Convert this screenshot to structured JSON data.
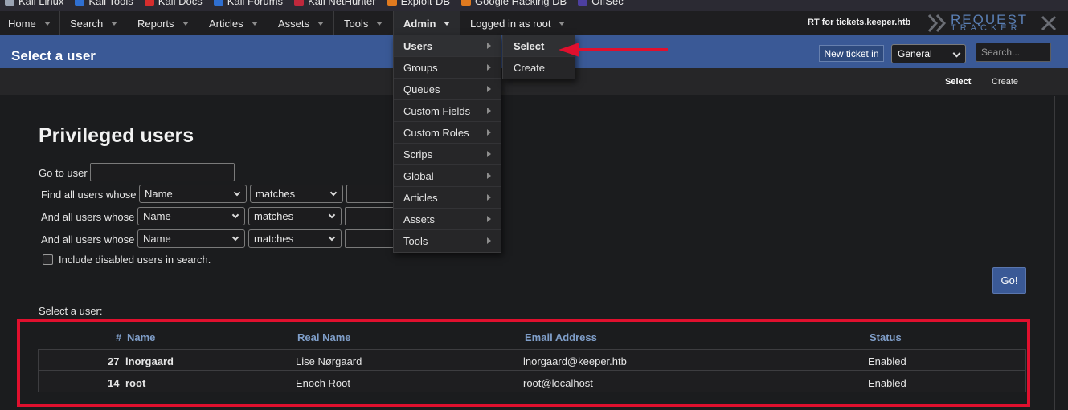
{
  "bookmarks": [
    {
      "label": "Kali Linux",
      "icon": "kali-icon",
      "color": "#9aa3b3"
    },
    {
      "label": "Kali Tools",
      "icon": "kali-icon",
      "color": "#2f6fd1"
    },
    {
      "label": "Kali Docs",
      "icon": "docs-icon",
      "color": "#d62d2d"
    },
    {
      "label": "Kali Forums",
      "icon": "kali-icon",
      "color": "#2f6fd1"
    },
    {
      "label": "Kali NetHunter",
      "icon": "nethunter-icon",
      "color": "#c0283c"
    },
    {
      "label": "Exploit-DB",
      "icon": "exploitdb-icon",
      "color": "#e07a1f"
    },
    {
      "label": "Google Hacking DB",
      "icon": "exploitdb-icon",
      "color": "#e07a1f"
    },
    {
      "label": "OffSec",
      "icon": "offsec-icon",
      "color": "#4d3fa0"
    }
  ],
  "nav": {
    "items": [
      "Home",
      "Search",
      "Reports",
      "Articles",
      "Assets",
      "Tools",
      "Admin",
      "Logged in as root"
    ],
    "host": "RT for tickets.keeper.htb",
    "logo_top": "REQUEST",
    "logo_bottom": "TRACKER"
  },
  "titlebar": {
    "title": "Select a user",
    "new_ticket": "New ticket in",
    "queue": "General",
    "search_placeholder": "Search..."
  },
  "subtabs": {
    "select": "Select",
    "create": "Create"
  },
  "form": {
    "heading": "Privileged users",
    "goto_label": "Go to user",
    "row1_label": "Find all users whose",
    "row2_label": "And all users whose",
    "row3_label": "And all users whose",
    "field": "Name",
    "op": "matches",
    "include_disabled": "Include disabled users in search.",
    "go": "Go!",
    "select_label": "Select a user:"
  },
  "table": {
    "headers": {
      "num": "#",
      "name": "Name",
      "real_name": "Real Name",
      "email": "Email Address",
      "status": "Status"
    },
    "rows": [
      {
        "id": "27",
        "name": "lnorgaard",
        "real_name": "Lise Nørgaard",
        "email": "lnorgaard@keeper.htb",
        "status": "Enabled"
      },
      {
        "id": "14",
        "name": "root",
        "real_name": "Enoch Root",
        "email": "root@localhost",
        "status": "Enabled"
      }
    ]
  },
  "admin_menu": {
    "items": [
      "Users",
      "Groups",
      "Queues",
      "Custom Fields",
      "Custom Roles",
      "Scrips",
      "Global",
      "Articles",
      "Assets",
      "Tools"
    ],
    "submenu": [
      "Select",
      "Create"
    ]
  },
  "colors": {
    "accent": "#3a5996",
    "annotation": "#e0102e",
    "table_header": "#7f9ec9"
  }
}
